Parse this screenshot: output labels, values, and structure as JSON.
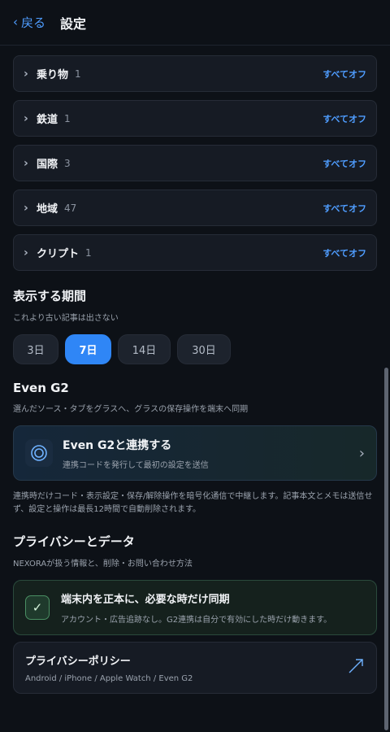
{
  "header": {
    "back_label": "戻る",
    "title": "設定"
  },
  "categories": [
    {
      "name": "乗り物",
      "count": "1",
      "action": "すべてオフ"
    },
    {
      "name": "鉄道",
      "count": "1",
      "action": "すべてオフ"
    },
    {
      "name": "国際",
      "count": "3",
      "action": "すべてオフ"
    },
    {
      "name": "地域",
      "count": "47",
      "action": "すべてオフ"
    },
    {
      "name": "クリプト",
      "count": "1",
      "action": "すべてオフ"
    }
  ],
  "period": {
    "title": "表示する期間",
    "subtitle": "これより古い記事は出さない",
    "options": [
      "3日",
      "7日",
      "14日",
      "30日"
    ],
    "selected": "7日"
  },
  "even_g2": {
    "title": "Even G2",
    "subtitle": "選んだソース・タブをグラスへ、グラスの保存操作を端末へ同期",
    "card_title": "Even G2と連携する",
    "card_subtitle": "連携コードを発行して最初の設定を送信",
    "note": "連携時だけコード・表示設定・保存/解除操作を暗号化通信で中継します。記事本文とメモは送信せず、設定と操作は最長12時間で自動削除されます。"
  },
  "privacy": {
    "title": "プライバシーとデータ",
    "subtitle": "NEXORAが扱う情報と、削除・お問い合わせ方法",
    "sync_title": "端末内を正本に、必要な時だけ同期",
    "sync_subtitle": "アカウント・広告追跡なし。G2連携は自分で有効にした時だけ動きます。",
    "policy_title": "プライバシーポリシー",
    "policy_subtitle": "Android / iPhone / Apple Watch / Even G2"
  },
  "colors": {
    "accent": "#2f86f6",
    "link": "#4f9dff",
    "background": "#0d1117",
    "success": "#4a8f63"
  },
  "icons": {
    "back": "chevron-left-icon",
    "expand": "chevron-right-icon",
    "g2": "rings-icon",
    "check": "check-icon",
    "external": "external-arrow-icon"
  }
}
